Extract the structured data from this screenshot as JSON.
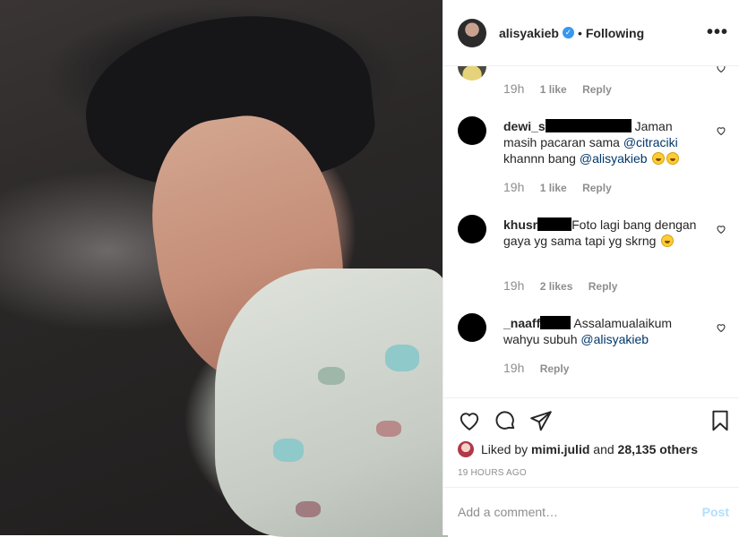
{
  "header": {
    "username": "alisyakieb",
    "verified_icon": "✓",
    "separator": "•",
    "follow_status": "Following",
    "more_icon": "•••"
  },
  "comments": [
    {
      "username": "",
      "text": "",
      "time": "19h",
      "likes": "1 like",
      "reply": "Reply",
      "partial": true
    },
    {
      "username": "dewi_s",
      "text_segments": [
        "Jaman masih pacaran sama ",
        "@citraciki",
        " khannn bang ",
        "@alisyakieb"
      ],
      "time": "19h",
      "likes": "1 like",
      "reply": "Reply"
    },
    {
      "username": "khusr",
      "text": "Foto lagi bang dengan gaya yg sama tapi yg skrng",
      "time": "19h",
      "likes": "2 likes",
      "reply": "Reply"
    },
    {
      "username": "_naaff",
      "text_segments": [
        "Assalamualaikum wahyu subuh ",
        "@alisyakieb"
      ],
      "time": "19h",
      "reply": "Reply"
    }
  ],
  "likes": {
    "prefix": "Liked by",
    "user": "mimi.julid",
    "conjunction": "and",
    "others": "28,135 others"
  },
  "timestamp": "19 HOURS AGO",
  "comment_box": {
    "placeholder": "Add a comment…",
    "post_label": "Post"
  },
  "colors": {
    "mention": "#00376b",
    "verified": "#3897f0",
    "post_disabled": "#b2dffc",
    "muted": "#8e8e8e"
  }
}
